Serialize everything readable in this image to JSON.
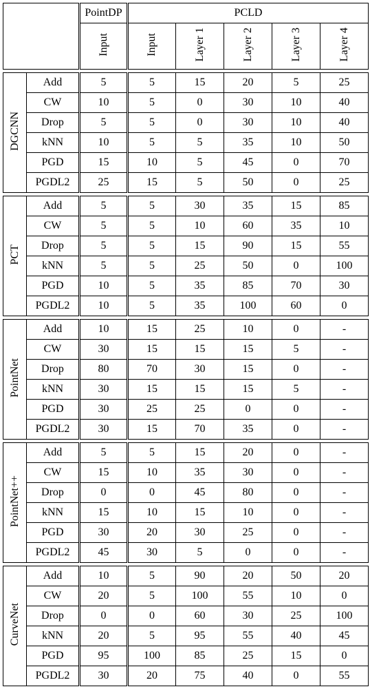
{
  "header": {
    "pointdp": "PointDP",
    "pcld": "PCLD",
    "cols_pointdp": [
      "Input"
    ],
    "cols_pcld": [
      "Input",
      "Layer 1",
      "Layer 2",
      "Layer 3",
      "Layer 4"
    ]
  },
  "attacks": [
    "Add",
    "CW",
    "Drop",
    "kNN",
    "PGD",
    "PGDL2"
  ],
  "groups": [
    {
      "name": "DGCNN",
      "rows": [
        {
          "attack": "Add",
          "pointdp": 5,
          "pcld": [
            5,
            15,
            20,
            5,
            25
          ]
        },
        {
          "attack": "CW",
          "pointdp": 10,
          "pcld": [
            5,
            0,
            30,
            10,
            40
          ]
        },
        {
          "attack": "Drop",
          "pointdp": 5,
          "pcld": [
            5,
            0,
            30,
            10,
            40
          ]
        },
        {
          "attack": "kNN",
          "pointdp": 10,
          "pcld": [
            5,
            5,
            35,
            10,
            50
          ]
        },
        {
          "attack": "PGD",
          "pointdp": 15,
          "pcld": [
            10,
            5,
            45,
            0,
            70
          ]
        },
        {
          "attack": "PGDL2",
          "pointdp": 25,
          "pcld": [
            15,
            5,
            50,
            0,
            25
          ]
        }
      ]
    },
    {
      "name": "PCT",
      "rows": [
        {
          "attack": "Add",
          "pointdp": 5,
          "pcld": [
            5,
            30,
            35,
            15,
            85
          ]
        },
        {
          "attack": "CW",
          "pointdp": 5,
          "pcld": [
            5,
            10,
            60,
            35,
            10
          ]
        },
        {
          "attack": "Drop",
          "pointdp": 5,
          "pcld": [
            5,
            15,
            90,
            15,
            55
          ]
        },
        {
          "attack": "kNN",
          "pointdp": 5,
          "pcld": [
            5,
            25,
            50,
            0,
            100
          ]
        },
        {
          "attack": "PGD",
          "pointdp": 10,
          "pcld": [
            5,
            35,
            85,
            70,
            30
          ]
        },
        {
          "attack": "PGDL2",
          "pointdp": 10,
          "pcld": [
            5,
            35,
            100,
            60,
            0
          ]
        }
      ]
    },
    {
      "name": "PointNet",
      "rows": [
        {
          "attack": "Add",
          "pointdp": 10,
          "pcld": [
            15,
            25,
            10,
            0,
            "-"
          ]
        },
        {
          "attack": "CW",
          "pointdp": 30,
          "pcld": [
            15,
            15,
            15,
            5,
            "-"
          ]
        },
        {
          "attack": "Drop",
          "pointdp": 80,
          "pcld": [
            70,
            30,
            15,
            0,
            "-"
          ]
        },
        {
          "attack": "kNN",
          "pointdp": 30,
          "pcld": [
            15,
            15,
            15,
            5,
            "-"
          ]
        },
        {
          "attack": "PGD",
          "pointdp": 30,
          "pcld": [
            25,
            25,
            0,
            0,
            "-"
          ]
        },
        {
          "attack": "PGDL2",
          "pointdp": 30,
          "pcld": [
            15,
            70,
            35,
            0,
            "-"
          ]
        }
      ]
    },
    {
      "name": "PointNet++",
      "rows": [
        {
          "attack": "Add",
          "pointdp": 5,
          "pcld": [
            5,
            15,
            20,
            0,
            "-"
          ]
        },
        {
          "attack": "CW",
          "pointdp": 15,
          "pcld": [
            10,
            35,
            30,
            0,
            "-"
          ]
        },
        {
          "attack": "Drop",
          "pointdp": 0,
          "pcld": [
            0,
            45,
            80,
            0,
            "-"
          ]
        },
        {
          "attack": "kNN",
          "pointdp": 15,
          "pcld": [
            10,
            15,
            10,
            0,
            "-"
          ]
        },
        {
          "attack": "PGD",
          "pointdp": 30,
          "pcld": [
            20,
            30,
            25,
            0,
            "-"
          ]
        },
        {
          "attack": "PGDL2",
          "pointdp": 45,
          "pcld": [
            30,
            5,
            0,
            0,
            "-"
          ]
        }
      ]
    },
    {
      "name": "CurveNet",
      "rows": [
        {
          "attack": "Add",
          "pointdp": 10,
          "pcld": [
            5,
            90,
            20,
            50,
            20
          ]
        },
        {
          "attack": "CW",
          "pointdp": 20,
          "pcld": [
            5,
            100,
            55,
            10,
            0
          ]
        },
        {
          "attack": "Drop",
          "pointdp": 0,
          "pcld": [
            0,
            60,
            30,
            25,
            100
          ]
        },
        {
          "attack": "kNN",
          "pointdp": 20,
          "pcld": [
            5,
            95,
            55,
            40,
            45
          ]
        },
        {
          "attack": "PGD",
          "pointdp": 95,
          "pcld": [
            100,
            85,
            25,
            15,
            0
          ]
        },
        {
          "attack": "PGDL2",
          "pointdp": 30,
          "pcld": [
            20,
            75,
            40,
            0,
            55
          ]
        }
      ]
    }
  ],
  "chart_data": {
    "type": "table",
    "row_groups": [
      "DGCNN",
      "PCT",
      "PointNet",
      "PointNet++",
      "CurveNet"
    ],
    "row_subkeys": [
      "Add",
      "CW",
      "Drop",
      "kNN",
      "PGD",
      "PGDL2"
    ],
    "col_groups": {
      "PointDP": [
        "Input"
      ],
      "PCLD": [
        "Input",
        "Layer 1",
        "Layer 2",
        "Layer 3",
        "Layer 4"
      ]
    },
    "values": {
      "DGCNN": {
        "Add": {
          "PointDP.Input": 5,
          "PCLD.Input": 5,
          "PCLD.Layer 1": 15,
          "PCLD.Layer 2": 20,
          "PCLD.Layer 3": 5,
          "PCLD.Layer 4": 25
        },
        "CW": {
          "PointDP.Input": 10,
          "PCLD.Input": 5,
          "PCLD.Layer 1": 0,
          "PCLD.Layer 2": 30,
          "PCLD.Layer 3": 10,
          "PCLD.Layer 4": 40
        },
        "Drop": {
          "PointDP.Input": 5,
          "PCLD.Input": 5,
          "PCLD.Layer 1": 0,
          "PCLD.Layer 2": 30,
          "PCLD.Layer 3": 10,
          "PCLD.Layer 4": 40
        },
        "kNN": {
          "PointDP.Input": 10,
          "PCLD.Input": 5,
          "PCLD.Layer 1": 5,
          "PCLD.Layer 2": 35,
          "PCLD.Layer 3": 10,
          "PCLD.Layer 4": 50
        },
        "PGD": {
          "PointDP.Input": 15,
          "PCLD.Input": 10,
          "PCLD.Layer 1": 5,
          "PCLD.Layer 2": 45,
          "PCLD.Layer 3": 0,
          "PCLD.Layer 4": 70
        },
        "PGDL2": {
          "PointDP.Input": 25,
          "PCLD.Input": 15,
          "PCLD.Layer 1": 5,
          "PCLD.Layer 2": 50,
          "PCLD.Layer 3": 0,
          "PCLD.Layer 4": 25
        }
      },
      "PCT": {
        "Add": {
          "PointDP.Input": 5,
          "PCLD.Input": 5,
          "PCLD.Layer 1": 30,
          "PCLD.Layer 2": 35,
          "PCLD.Layer 3": 15,
          "PCLD.Layer 4": 85
        },
        "CW": {
          "PointDP.Input": 5,
          "PCLD.Input": 5,
          "PCLD.Layer 1": 10,
          "PCLD.Layer 2": 60,
          "PCLD.Layer 3": 35,
          "PCLD.Layer 4": 10
        },
        "Drop": {
          "PointDP.Input": 5,
          "PCLD.Input": 5,
          "PCLD.Layer 1": 15,
          "PCLD.Layer 2": 90,
          "PCLD.Layer 3": 15,
          "PCLD.Layer 4": 55
        },
        "kNN": {
          "PointDP.Input": 5,
          "PCLD.Input": 5,
          "PCLD.Layer 1": 25,
          "PCLD.Layer 2": 50,
          "PCLD.Layer 3": 0,
          "PCLD.Layer 4": 100
        },
        "PGD": {
          "PointDP.Input": 10,
          "PCLD.Input": 5,
          "PCLD.Layer 1": 35,
          "PCLD.Layer 2": 85,
          "PCLD.Layer 3": 70,
          "PCLD.Layer 4": 30
        },
        "PGDL2": {
          "PointDP.Input": 10,
          "PCLD.Input": 5,
          "PCLD.Layer 1": 35,
          "PCLD.Layer 2": 100,
          "PCLD.Layer 3": 60,
          "PCLD.Layer 4": 0
        }
      },
      "PointNet": {
        "Add": {
          "PointDP.Input": 10,
          "PCLD.Input": 15,
          "PCLD.Layer 1": 25,
          "PCLD.Layer 2": 10,
          "PCLD.Layer 3": 0,
          "PCLD.Layer 4": "-"
        },
        "CW": {
          "PointDP.Input": 30,
          "PCLD.Input": 15,
          "PCLD.Layer 1": 15,
          "PCLD.Layer 2": 15,
          "PCLD.Layer 3": 5,
          "PCLD.Layer 4": "-"
        },
        "Drop": {
          "PointDP.Input": 80,
          "PCLD.Input": 70,
          "PCLD.Layer 1": 30,
          "PCLD.Layer 2": 15,
          "PCLD.Layer 3": 0,
          "PCLD.Layer 4": "-"
        },
        "kNN": {
          "PointDP.Input": 30,
          "PCLD.Input": 15,
          "PCLD.Layer 1": 15,
          "PCLD.Layer 2": 15,
          "PCLD.Layer 3": 5,
          "PCLD.Layer 4": "-"
        },
        "PGD": {
          "PointDP.Input": 30,
          "PCLD.Input": 25,
          "PCLD.Layer 1": 25,
          "PCLD.Layer 2": 0,
          "PCLD.Layer 3": 0,
          "PCLD.Layer 4": "-"
        },
        "PGDL2": {
          "PointDP.Input": 30,
          "PCLD.Input": 15,
          "PCLD.Layer 1": 70,
          "PCLD.Layer 2": 35,
          "PCLD.Layer 3": 0,
          "PCLD.Layer 4": "-"
        }
      },
      "PointNet++": {
        "Add": {
          "PointDP.Input": 5,
          "PCLD.Input": 5,
          "PCLD.Layer 1": 15,
          "PCLD.Layer 2": 20,
          "PCLD.Layer 3": 0,
          "PCLD.Layer 4": "-"
        },
        "CW": {
          "PointDP.Input": 15,
          "PCLD.Input": 10,
          "PCLD.Layer 1": 35,
          "PCLD.Layer 2": 30,
          "PCLD.Layer 3": 0,
          "PCLD.Layer 4": "-"
        },
        "Drop": {
          "PointDP.Input": 0,
          "PCLD.Input": 0,
          "PCLD.Layer 1": 45,
          "PCLD.Layer 2": 80,
          "PCLD.Layer 3": 0,
          "PCLD.Layer 4": "-"
        },
        "kNN": {
          "PointDP.Input": 15,
          "PCLD.Input": 10,
          "PCLD.Layer 1": 15,
          "PCLD.Layer 2": 10,
          "PCLD.Layer 3": 0,
          "PCLD.Layer 4": "-"
        },
        "PGD": {
          "PointDP.Input": 30,
          "PCLD.Input": 20,
          "PCLD.Layer 1": 30,
          "PCLD.Layer 2": 25,
          "PCLD.Layer 3": 0,
          "PCLD.Layer 4": "-"
        },
        "PGDL2": {
          "PointDP.Input": 45,
          "PCLD.Input": 30,
          "PCLD.Layer 1": 5,
          "PCLD.Layer 2": 0,
          "PCLD.Layer 3": 0,
          "PCLD.Layer 4": "-"
        }
      },
      "CurveNet": {
        "Add": {
          "PointDP.Input": 10,
          "PCLD.Input": 5,
          "PCLD.Layer 1": 90,
          "PCLD.Layer 2": 20,
          "PCLD.Layer 3": 50,
          "PCLD.Layer 4": 20
        },
        "CW": {
          "PointDP.Input": 20,
          "PCLD.Input": 5,
          "PCLD.Layer 1": 100,
          "PCLD.Layer 2": 55,
          "PCLD.Layer 3": 10,
          "PCLD.Layer 4": 0
        },
        "Drop": {
          "PointDP.Input": 0,
          "PCLD.Input": 0,
          "PCLD.Layer 1": 60,
          "PCLD.Layer 2": 30,
          "PCLD.Layer 3": 25,
          "PCLD.Layer 4": 100
        },
        "kNN": {
          "PointDP.Input": 20,
          "PCLD.Input": 5,
          "PCLD.Layer 1": 95,
          "PCLD.Layer 2": 55,
          "PCLD.Layer 3": 40,
          "PCLD.Layer 4": 45
        },
        "PGD": {
          "PointDP.Input": 95,
          "PCLD.Input": 100,
          "PCLD.Layer 1": 85,
          "PCLD.Layer 2": 25,
          "PCLD.Layer 3": 15,
          "PCLD.Layer 4": 0
        },
        "PGDL2": {
          "PointDP.Input": 30,
          "PCLD.Input": 20,
          "PCLD.Layer 1": 75,
          "PCLD.Layer 2": 40,
          "PCLD.Layer 3": 0,
          "PCLD.Layer 4": 55
        }
      }
    }
  }
}
